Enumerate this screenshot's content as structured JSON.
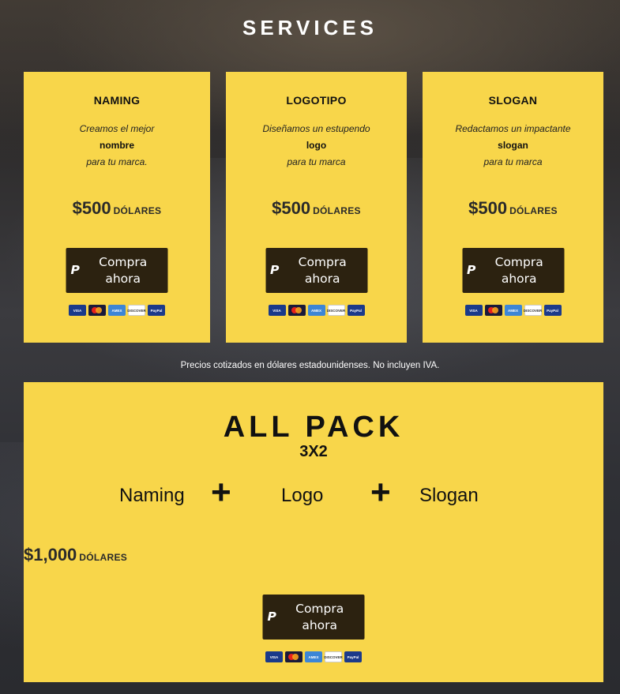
{
  "header": {
    "title": "SERVICES"
  },
  "services": [
    {
      "name": "NAMING",
      "line1": "Creamos el mejor",
      "keyword": "nombre",
      "line2": "para tu marca.",
      "price": "$500",
      "currency": "DÓLARES",
      "button": "Compra ahora"
    },
    {
      "name": "LOGOTIPO",
      "line1": "Diseñamos un estupendo",
      "keyword": "logo",
      "line2": "para tu marca",
      "price": "$500",
      "currency": "DÓLARES",
      "button": "Compra ahora"
    },
    {
      "name": "SLOGAN",
      "line1": "Redactamos un impactante",
      "keyword": "slogan",
      "line2": "para tu marca",
      "price": "$500",
      "currency": "DÓLARES",
      "button": "Compra ahora"
    }
  ],
  "payment_icons": [
    "VISA",
    "mastercard",
    "AMEX",
    "DISCOVER",
    "PayPal"
  ],
  "note": "Precios cotizados en dólares estadounidenses. No incluyen IVA.",
  "pack": {
    "title": "ALL PACK",
    "subtitle": "3X2",
    "items": [
      "Naming",
      "Logo",
      "Slogan"
    ],
    "plus": "+",
    "price": "$1,000",
    "currency": "DÓLARES",
    "button": "Compra ahora"
  },
  "colors": {
    "card_bg": "#f8d64a",
    "button_bg": "#2c2210"
  },
  "icons": {
    "paypal": "paypal-icon"
  }
}
